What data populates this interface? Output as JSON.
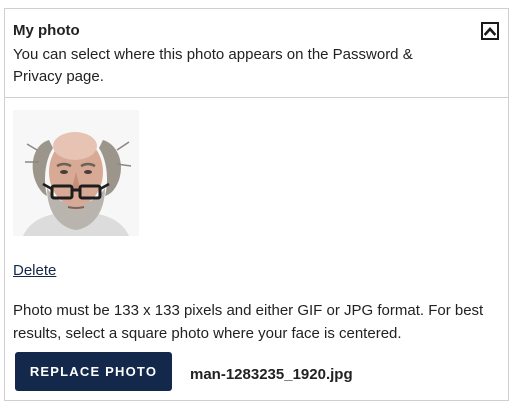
{
  "panel": {
    "title": "My photo",
    "description": "You can select where this photo appears on the Password & Privacy page.",
    "collapse_icon": "chevron-up-icon"
  },
  "photo": {
    "subject": "profile-photo"
  },
  "actions": {
    "delete_label": "Delete",
    "help_text": "Photo must be 133 x 133 pixels and either GIF or JPG format. For best results, select a square photo where your face is centered.",
    "replace_label": "REPLACE PHOTO",
    "file_name": "man-1283235_1920.jpg"
  },
  "colors": {
    "button_bg": "#14284c",
    "link": "#15264a",
    "border": "#cfcfcf"
  }
}
